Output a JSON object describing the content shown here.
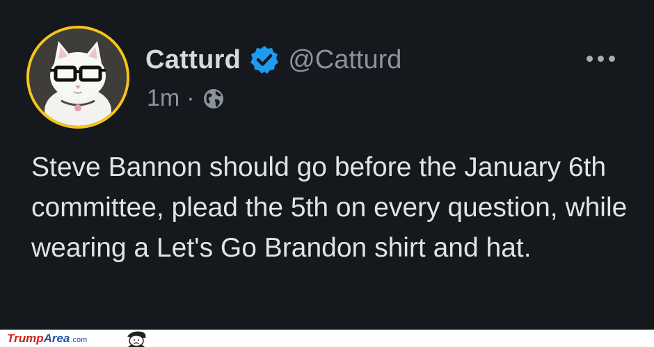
{
  "tweet": {
    "display_name": "Catturd",
    "handle": "@Catturd",
    "time": "1m",
    "separator": "·",
    "verified_icon": "verified-badge-icon",
    "visibility_icon": "globe-icon",
    "more_icon": "more-options-icon",
    "text": "Steve Bannon should go before the January 6th committee, plead the 5th on every question, while wearing a Let's Go Brandon shirt and hat."
  },
  "watermark": {
    "part1": "Trump",
    "part2": "Area",
    "part3": ".com"
  },
  "colors": {
    "background": "#15181c",
    "avatar_ring": "#f5c518",
    "verified": "#1d9bf0",
    "name": "#d9d9d9",
    "muted": "#8b949e",
    "text": "#e3e3e3"
  }
}
